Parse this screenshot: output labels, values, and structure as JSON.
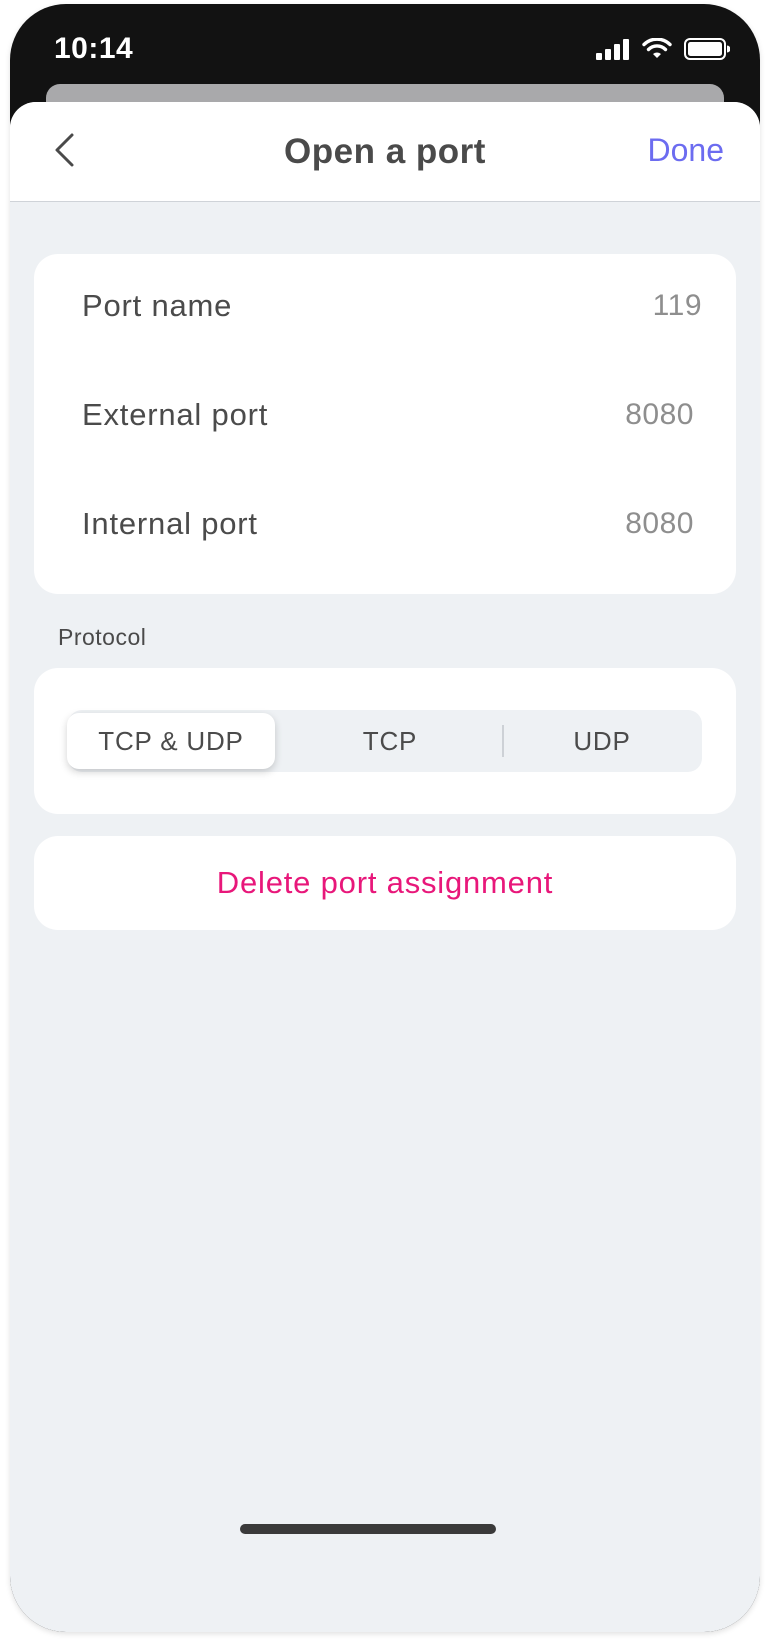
{
  "status_bar": {
    "time": "10:14",
    "icons": [
      "cellular-signal-icon",
      "wifi-icon",
      "battery-icon"
    ]
  },
  "nav": {
    "back_icon": "chevron-left-icon",
    "title": "Open a port",
    "done_label": "Done"
  },
  "fields": [
    {
      "label": "Port name",
      "value": "119"
    },
    {
      "label": "External port",
      "value": "8080"
    },
    {
      "label": "Internal port",
      "value": "8080"
    }
  ],
  "protocol": {
    "section_label": "Protocol",
    "options": [
      "TCP & UDP",
      "TCP",
      "UDP"
    ],
    "selected": "TCP & UDP"
  },
  "delete": {
    "label": "Delete port assignment"
  },
  "colors": {
    "accent": "#6c6cf0",
    "destructive": "#e8177a",
    "background": "#eef1f4"
  }
}
